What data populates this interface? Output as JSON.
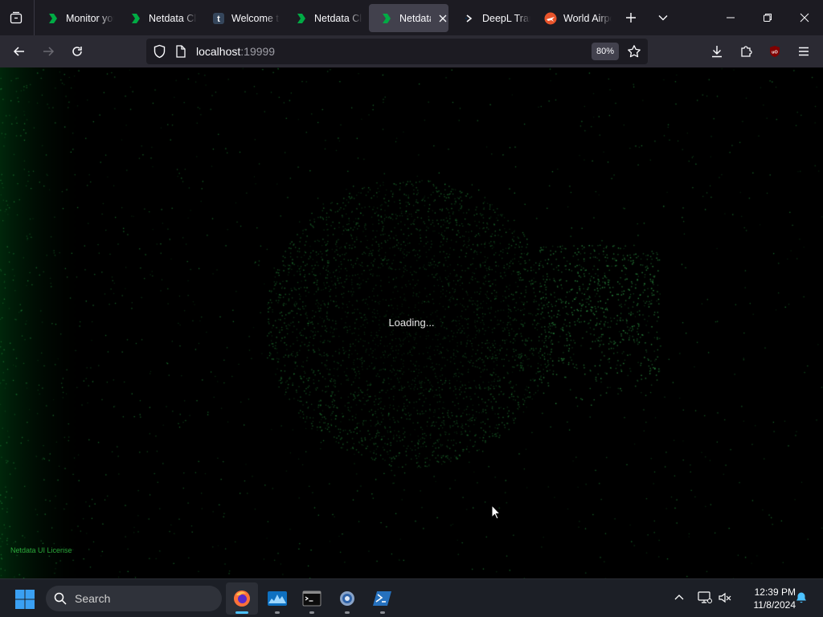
{
  "browser": {
    "tabs": [
      {
        "title": "Monitor your",
        "icon": "netdata-icon",
        "active": false
      },
      {
        "title": "Netdata Cloud",
        "icon": "netdata-icon",
        "active": false
      },
      {
        "title": "Welcome to",
        "icon": "tumblr-icon",
        "active": false
      },
      {
        "title": "Netdata Cloud",
        "icon": "netdata-icon",
        "active": false
      },
      {
        "title": "Netdata",
        "icon": "netdata-icon",
        "active": true
      },
      {
        "title": "DeepL Translate",
        "icon": "deepl-icon",
        "active": false
      },
      {
        "title": "World Airports",
        "icon": "airport-icon",
        "active": false
      }
    ],
    "url_host": "localhost",
    "url_port": ":19999",
    "zoom": "80%"
  },
  "page": {
    "loading_text": "Loading...",
    "license_link": "Netdata UI License"
  },
  "taskbar": {
    "search_placeholder": "Search",
    "apps": [
      {
        "name": "firefox-icon",
        "active": true
      },
      {
        "name": "netdata-monitor-icon",
        "active": false
      },
      {
        "name": "terminal-icon",
        "active": false
      },
      {
        "name": "settings-icon",
        "active": false
      },
      {
        "name": "powershell-icon",
        "active": false
      }
    ],
    "time": "12:39 PM",
    "date": "11/8/2024"
  },
  "colors": {
    "accent_green": "#00ab44",
    "active_indicator": "#4cc2ff"
  }
}
